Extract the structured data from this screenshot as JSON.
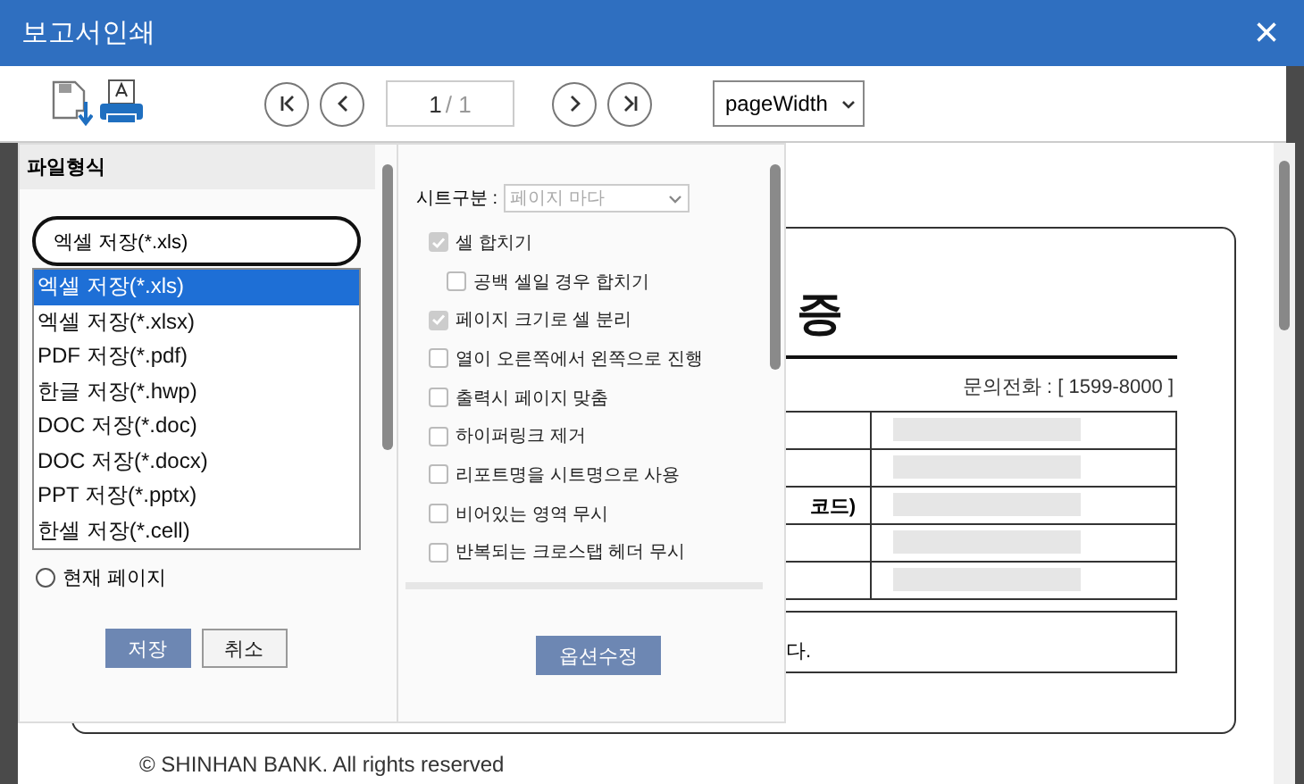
{
  "window": {
    "title": "보고서인쇄",
    "close": "×"
  },
  "toolbar": {
    "page_field": {
      "current": "1",
      "total": "/ 1"
    },
    "zoom_select": "pageWidth"
  },
  "document": {
    "title": "증",
    "phone": "문의전화 : [ 1599-8000 ]",
    "table_rows": [
      {
        "label": ""
      },
      {
        "label": ""
      },
      {
        "label": "코드)"
      },
      {
        "label": ""
      },
      {
        "label": ""
      }
    ],
    "note": "다.",
    "footer": "© SHINHAN BANK. All rights reserved"
  },
  "file_panel": {
    "header": "파일형식",
    "format_select": "엑셀 저장(*.xls)",
    "format_options": [
      {
        "label": "엑셀 저장(*.xls)",
        "selected": true
      },
      {
        "label": "엑셀 저장(*.xlsx)",
        "selected": false
      },
      {
        "label": "PDF 저장(*.pdf)",
        "selected": false
      },
      {
        "label": "한글 저장(*.hwp)",
        "selected": false
      },
      {
        "label": "DOC 저장(*.doc)",
        "selected": false
      },
      {
        "label": "DOC 저장(*.docx)",
        "selected": false
      },
      {
        "label": "PPT 저장(*.pptx)",
        "selected": false
      },
      {
        "label": "한셀 저장(*.cell)",
        "selected": false
      }
    ],
    "radio": {
      "label": "현재 페이지",
      "selected": false
    },
    "buttons": [
      {
        "label": "저장",
        "kind": "primary"
      },
      {
        "label": "취소",
        "kind": "secondary"
      }
    ]
  },
  "options_panel": {
    "sheet_label": "시트구분 :",
    "sheet_select": {
      "value": "페이지 마다",
      "disabled": true
    },
    "checkboxes": [
      {
        "label": "셀 합치기",
        "checked": true,
        "disabled": true,
        "children": [
          {
            "label": "공백 셀일 경우 합치기",
            "checked": false,
            "disabled": false
          }
        ]
      },
      {
        "label": "페이지 크기로 셀 분리",
        "checked": true,
        "disabled": true
      },
      {
        "label": "열이 오른쪽에서 왼쪽으로 진행",
        "checked": false,
        "disabled": false
      },
      {
        "label": "출력시 페이지 맞춤",
        "checked": false,
        "disabled": false
      },
      {
        "label": "하이퍼링크 제거",
        "checked": false,
        "disabled": false
      },
      {
        "label": "리포트명을 시트명으로 사용",
        "checked": false,
        "disabled": false
      },
      {
        "label": "비어있는 영역 무시",
        "checked": false,
        "disabled": false
      },
      {
        "label": "반복되는 크로스탭 헤더 무시",
        "checked": false,
        "disabled": false
      }
    ],
    "button": "옵션수정"
  }
}
